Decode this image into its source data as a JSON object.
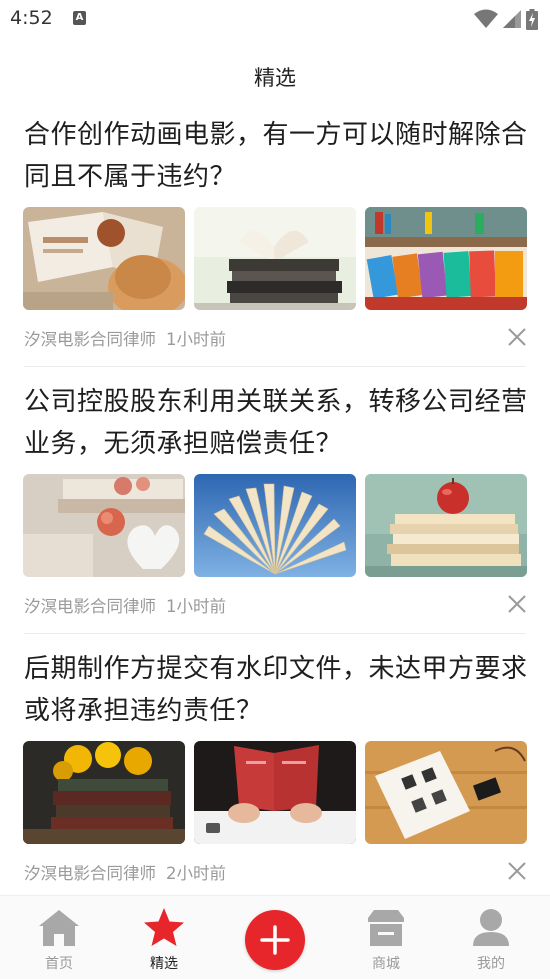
{
  "status_bar": {
    "time": "4:52",
    "notification_icon": "a-letter-icon",
    "right_icons": [
      "wifi-icon",
      "cellular-signal-icon",
      "battery-charging-icon"
    ]
  },
  "header": {
    "title": "精选"
  },
  "articles": [
    {
      "title": "合作创作动画电影，有一方可以随时解除合同且不属于违约？",
      "images": [
        "open-magazine-child-photo",
        "heart-shaped-book-stack-photo",
        "bookshelf-colorful-books-photo"
      ],
      "author": "汐溟电影合同律师",
      "time": "1小时前"
    },
    {
      "title": "公司控股股东利用关联关系，转移公司经营业务，无须承担赔偿责任？",
      "images": [
        "roses-books-heart-photo",
        "open-book-blue-sky-photo",
        "apple-on-books-photo"
      ],
      "author": "汐溟电影合同律师",
      "time": "1小时前"
    },
    {
      "title": "后期制作方提交有水印文件，未达甲方要求或将承担违约责任？",
      "images": [
        "yellow-roses-old-books-photo",
        "hands-red-book-photo",
        "open-book-wood-desk-photo"
      ],
      "author": "汐溟电影合同律师",
      "time": "2小时前"
    }
  ],
  "tabbar": {
    "items": [
      {
        "label": "首页",
        "icon": "home-icon"
      },
      {
        "label": "精选",
        "icon": "star-icon",
        "active": true
      },
      {
        "label": "",
        "icon": "plus-icon"
      },
      {
        "label": "商城",
        "icon": "store-icon"
      },
      {
        "label": "我的",
        "icon": "user-icon"
      }
    ]
  },
  "colors": {
    "accent": "#e6262b",
    "muted": "#9a9a9a",
    "inactive_icon": "#a8a8a8"
  }
}
